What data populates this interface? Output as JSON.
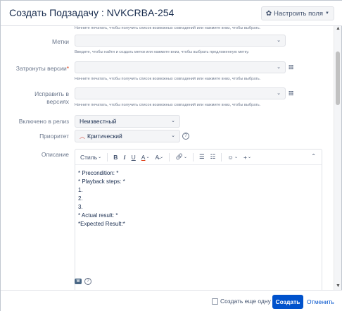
{
  "header": {
    "title": "Создать Подзадачу : NVKCRBA-254",
    "configure_button": "Настроить поля"
  },
  "form": {
    "top_help": "Начните печатать, чтобы получить список возможных совпадений или нажмите вниз, чтобы выбрать.",
    "labels_field": {
      "label": "Метки",
      "help": "Введите, чтобы найти и создать метки или нажмите вниз, чтобы выбрать предложенную метку."
    },
    "affects_versions": {
      "label": "Затронуты версии",
      "required_mark": "*",
      "help": "Начните печатать, чтобы получить список возможных совпадений или нажмите вниз, чтобы выбрать."
    },
    "fix_versions": {
      "label_line1": "Исправить в",
      "label_line2": "версиях",
      "help": "Начните печатать, чтобы получить список возможных совпадений или нажмите вниз, чтобы выбрать."
    },
    "included_in_release": {
      "label": "Включено в релиз",
      "value": "Неизвестный"
    },
    "priority": {
      "label": "Приоритет",
      "value": "Критический"
    },
    "description": {
      "label": "Описание",
      "toolbar": {
        "style": "Стиль",
        "bold": "B",
        "italic": "I",
        "underline": "U",
        "text_color": "A"
      },
      "content_lines": [
        "* Precondition: *",
        "* Playback steps: *",
        "1.",
        "2.",
        "3.",
        "* Actual result: *",
        "*Expected Result:*"
      ]
    }
  },
  "footer": {
    "create_another": "Создать еще одну",
    "create_button": "Создать",
    "cancel_link": "Отменить"
  },
  "colors": {
    "primary": "#0052cc",
    "priority_icon": "#d04437",
    "required": "#de350b"
  }
}
